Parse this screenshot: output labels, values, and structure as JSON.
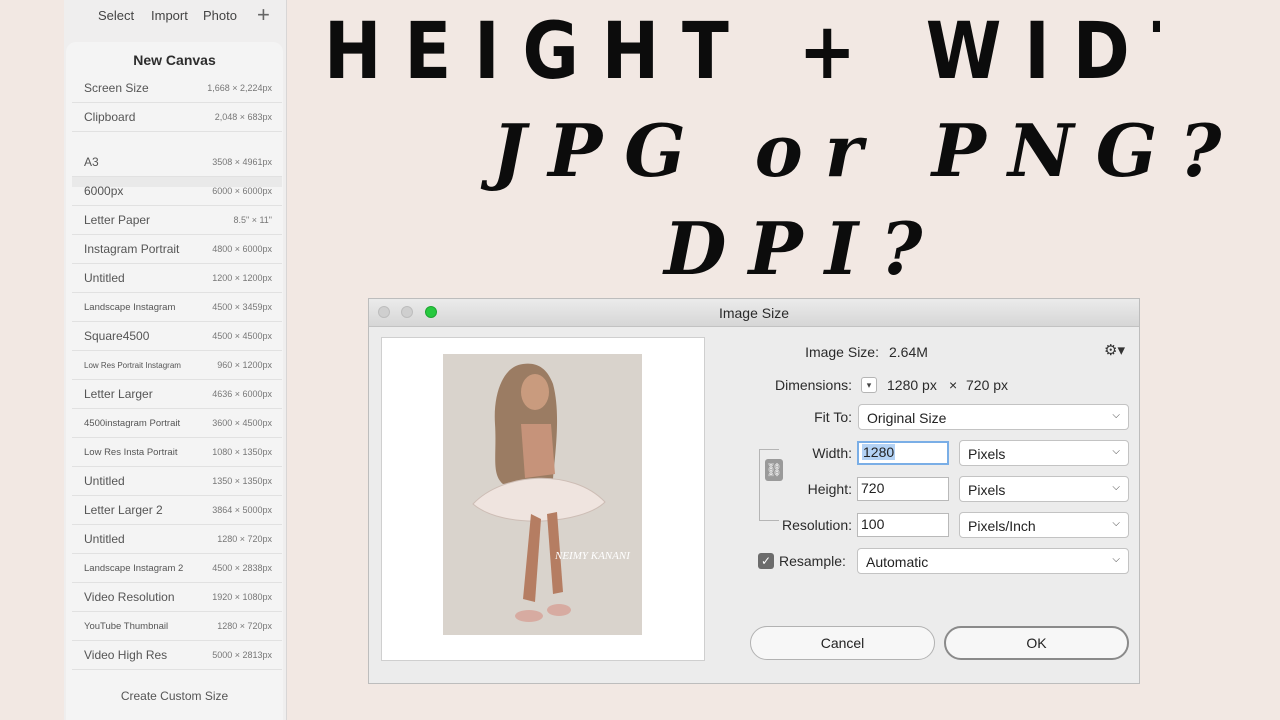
{
  "ipad": {
    "topbar": {
      "select": "Select",
      "import": "Import",
      "photo": "Photo",
      "add": "+"
    },
    "panel": {
      "title": "New Canvas",
      "top_items": [
        {
          "name": "Screen Size",
          "dims": "1,668 × 2,224px"
        },
        {
          "name": "Clipboard",
          "dims": "2,048 × 683px"
        }
      ],
      "items": [
        {
          "name": "A3",
          "dims": "3508 × 4961px"
        },
        {
          "name": "6000px",
          "dims": "6000 × 6000px"
        },
        {
          "name": "Letter Paper",
          "dims": "8.5\" × 11\""
        },
        {
          "name": "Instagram Portrait",
          "dims": "4800 × 6000px"
        },
        {
          "name": "Untitled",
          "dims": "1200 × 1200px"
        },
        {
          "name": "Landscape Instagram",
          "dims": "4500 × 3459px"
        },
        {
          "name": "Square4500",
          "dims": "4500 × 4500px"
        },
        {
          "name": "Low Res Portrait Instagram",
          "dims": "960 × 1200px"
        },
        {
          "name": "Letter Larger",
          "dims": "4636 × 6000px"
        },
        {
          "name": "4500instagram Portrait",
          "dims": "3600 × 4500px"
        },
        {
          "name": "Low Res Insta Portrait",
          "dims": "1080 × 1350px"
        },
        {
          "name": "Untitled",
          "dims": "1350 × 1350px"
        },
        {
          "name": "Letter Larger 2",
          "dims": "3864 × 5000px"
        },
        {
          "name": "Untitled",
          "dims": "1280 × 720px"
        },
        {
          "name": "Landscape Instagram 2",
          "dims": "4500 × 2838px"
        },
        {
          "name": "Video Resolution",
          "dims": "1920 × 1080px"
        },
        {
          "name": "YouTube Thumbnail",
          "dims": "1280 × 720px"
        },
        {
          "name": "Video High Res",
          "dims": "5000 × 2813px"
        }
      ],
      "create": "Create Custom Size"
    }
  },
  "headline": {
    "line1": "HEIGHT + WIDTH?",
    "line2": "JPG or PNG?",
    "line3": "DPI?"
  },
  "dialog": {
    "title": "Image Size",
    "image_size_label": "Image Size:",
    "image_size_value": "2.64M",
    "dimensions_label": "Dimensions:",
    "dimensions_width": "1280 px",
    "dimensions_x": "×",
    "dimensions_height": "720 px",
    "fit_to_label": "Fit To:",
    "fit_to_value": "Original Size",
    "width_label": "Width:",
    "width_value": "1280",
    "width_unit": "Pixels",
    "height_label": "Height:",
    "height_value": "720",
    "height_unit": "Pixels",
    "resolution_label": "Resolution:",
    "resolution_value": "100",
    "resolution_unit": "Pixels/Inch",
    "resample_label": "Resample:",
    "resample_checked": true,
    "resample_value": "Automatic",
    "cancel": "Cancel",
    "ok": "OK",
    "signature": "NEIMY KANANI"
  }
}
